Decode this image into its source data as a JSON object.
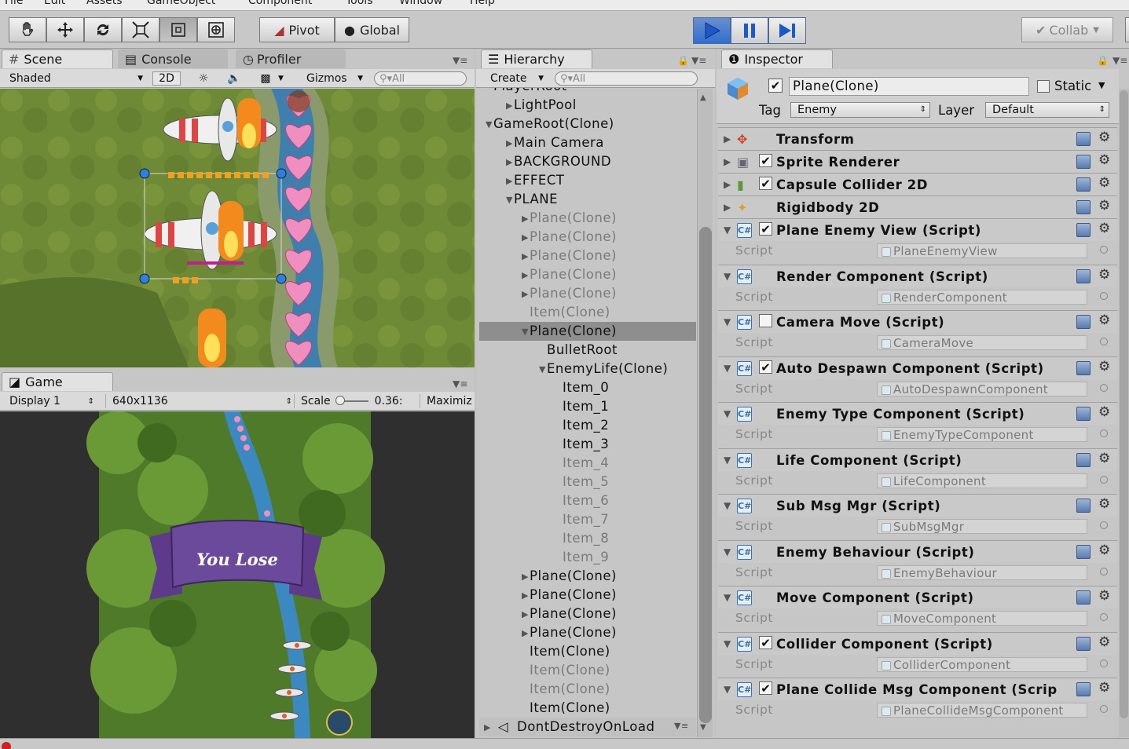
{
  "menu": {
    "items": [
      "File",
      "Edit",
      "Assets",
      "GameObject",
      "Component",
      "Tools",
      "Window",
      "Help"
    ]
  },
  "toolbar": {
    "pivot": "Pivot",
    "global": "Global",
    "collab": "Collab"
  },
  "scene": {
    "tab_scene": "Scene",
    "tab_console": "Console",
    "tab_profiler": "Profiler",
    "shading": "Shaded",
    "mode_2d": "2D",
    "gizmos": "Gizmos",
    "search": "All"
  },
  "game": {
    "tab": "Game",
    "display": "Display 1",
    "resolution": "640x1136",
    "scale_label": "Scale",
    "scale_value": "0.36:",
    "maximize": "Maximiz",
    "banner": "You Lose"
  },
  "hierarchy": {
    "tab": "Hierarchy",
    "create": "Create",
    "search": "All",
    "rows": [
      {
        "label": "PlayerRoot",
        "indent": 0,
        "dim": false,
        "sel": false,
        "arrow": "none"
      },
      {
        "label": "LightPool",
        "indent": 1,
        "dim": false,
        "sel": false,
        "arrow": "right"
      },
      {
        "label": "GameRoot(Clone)",
        "indent": 0,
        "dim": false,
        "sel": false,
        "arrow": "down"
      },
      {
        "label": "Main Camera",
        "indent": 1,
        "dim": false,
        "sel": false,
        "arrow": "right"
      },
      {
        "label": "BACKGROUND",
        "indent": 1,
        "dim": false,
        "sel": false,
        "arrow": "right"
      },
      {
        "label": "EFFECT",
        "indent": 1,
        "dim": false,
        "sel": false,
        "arrow": "right"
      },
      {
        "label": "PLANE",
        "indent": 1,
        "dim": false,
        "sel": false,
        "arrow": "down"
      },
      {
        "label": "Plane(Clone)",
        "indent": 2,
        "dim": true,
        "sel": false,
        "arrow": "right"
      },
      {
        "label": "Plane(Clone)",
        "indent": 2,
        "dim": true,
        "sel": false,
        "arrow": "right"
      },
      {
        "label": "Plane(Clone)",
        "indent": 2,
        "dim": true,
        "sel": false,
        "arrow": "right"
      },
      {
        "label": "Plane(Clone)",
        "indent": 2,
        "dim": true,
        "sel": false,
        "arrow": "right"
      },
      {
        "label": "Plane(Clone)",
        "indent": 2,
        "dim": true,
        "sel": false,
        "arrow": "right"
      },
      {
        "label": "Item(Clone)",
        "indent": 2,
        "dim": true,
        "sel": false,
        "arrow": "none"
      },
      {
        "label": "Plane(Clone)",
        "indent": 2,
        "dim": false,
        "sel": true,
        "arrow": "down"
      },
      {
        "label": "BulletRoot",
        "indent": 3,
        "dim": false,
        "sel": false,
        "arrow": "none"
      },
      {
        "label": "EnemyLife(Clone)",
        "indent": 3,
        "dim": false,
        "sel": false,
        "arrow": "down"
      },
      {
        "label": "Item_0",
        "indent": 4,
        "dim": false,
        "sel": false,
        "arrow": "none"
      },
      {
        "label": "Item_1",
        "indent": 4,
        "dim": false,
        "sel": false,
        "arrow": "none"
      },
      {
        "label": "Item_2",
        "indent": 4,
        "dim": false,
        "sel": false,
        "arrow": "none"
      },
      {
        "label": "Item_3",
        "indent": 4,
        "dim": false,
        "sel": false,
        "arrow": "none"
      },
      {
        "label": "Item_4",
        "indent": 4,
        "dim": true,
        "sel": false,
        "arrow": "none"
      },
      {
        "label": "Item_5",
        "indent": 4,
        "dim": true,
        "sel": false,
        "arrow": "none"
      },
      {
        "label": "Item_6",
        "indent": 4,
        "dim": true,
        "sel": false,
        "arrow": "none"
      },
      {
        "label": "Item_7",
        "indent": 4,
        "dim": true,
        "sel": false,
        "arrow": "none"
      },
      {
        "label": "Item_8",
        "indent": 4,
        "dim": true,
        "sel": false,
        "arrow": "none"
      },
      {
        "label": "Item_9",
        "indent": 4,
        "dim": true,
        "sel": false,
        "arrow": "none"
      },
      {
        "label": "Plane(Clone)",
        "indent": 2,
        "dim": false,
        "sel": false,
        "arrow": "right"
      },
      {
        "label": "Plane(Clone)",
        "indent": 2,
        "dim": false,
        "sel": false,
        "arrow": "right"
      },
      {
        "label": "Plane(Clone)",
        "indent": 2,
        "dim": false,
        "sel": false,
        "arrow": "right"
      },
      {
        "label": "Plane(Clone)",
        "indent": 2,
        "dim": false,
        "sel": false,
        "arrow": "right"
      },
      {
        "label": "Item(Clone)",
        "indent": 2,
        "dim": false,
        "sel": false,
        "arrow": "none"
      },
      {
        "label": "Item(Clone)",
        "indent": 2,
        "dim": true,
        "sel": false,
        "arrow": "none"
      },
      {
        "label": "Item(Clone)",
        "indent": 2,
        "dim": true,
        "sel": false,
        "arrow": "none"
      },
      {
        "label": "Item(Clone)",
        "indent": 2,
        "dim": false,
        "sel": false,
        "arrow": "none"
      }
    ],
    "dont_destroy": "DontDestroyOnLoad"
  },
  "inspector": {
    "tab": "Inspector",
    "object_name": "Plane(Clone)",
    "static_label": "Static",
    "tag_label": "Tag",
    "tag_value": "Enemy",
    "layer_label": "Layer",
    "layer_value": "Default",
    "script_key": "Script",
    "components": [
      {
        "name": "Transform",
        "checkbox": "none",
        "icon": "transform-icon",
        "script": null
      },
      {
        "name": "Sprite Renderer",
        "checkbox": "checked",
        "icon": "sprite-renderer-icon",
        "script": null
      },
      {
        "name": "Capsule Collider 2D",
        "checkbox": "checked",
        "icon": "capsule-collider-icon",
        "script": null
      },
      {
        "name": "Rigidbody 2D",
        "checkbox": "none",
        "icon": "rigidbody-icon",
        "script": null
      },
      {
        "name": "Plane Enemy View (Script)",
        "checkbox": "checked",
        "icon": "script-icon",
        "script": "PlaneEnemyView"
      },
      {
        "name": "Render Component (Script)",
        "checkbox": "none",
        "icon": "script-icon",
        "script": "RenderComponent"
      },
      {
        "name": "Camera Move (Script)",
        "checkbox": "unchecked",
        "icon": "script-icon",
        "script": "CameraMove"
      },
      {
        "name": "Auto Despawn Component (Script)",
        "checkbox": "checked",
        "icon": "script-icon",
        "script": "AutoDespawnComponent"
      },
      {
        "name": "Enemy Type Component (Script)",
        "checkbox": "none",
        "icon": "script-icon",
        "script": "EnemyTypeComponent"
      },
      {
        "name": "Life Component (Script)",
        "checkbox": "none",
        "icon": "script-icon",
        "script": "LifeComponent"
      },
      {
        "name": "Sub Msg Mgr (Script)",
        "checkbox": "none",
        "icon": "script-icon",
        "script": "SubMsgMgr"
      },
      {
        "name": "Enemy Behaviour (Script)",
        "checkbox": "none",
        "icon": "script-icon",
        "script": "EnemyBehaviour"
      },
      {
        "name": "Move Component (Script)",
        "checkbox": "none",
        "icon": "script-icon",
        "script": "MoveComponent"
      },
      {
        "name": "Collider Component (Script)",
        "checkbox": "checked",
        "icon": "script-icon",
        "script": "ColliderComponent"
      },
      {
        "name": "Plane Collide Msg Component (Scrip",
        "checkbox": "checked",
        "icon": "script-icon",
        "script": "PlaneCollideMsgComponent"
      }
    ]
  },
  "colors": {
    "play_blue": "#2f6fd0",
    "selection": "#8e8e8e",
    "panel": "#c6c6c6"
  }
}
